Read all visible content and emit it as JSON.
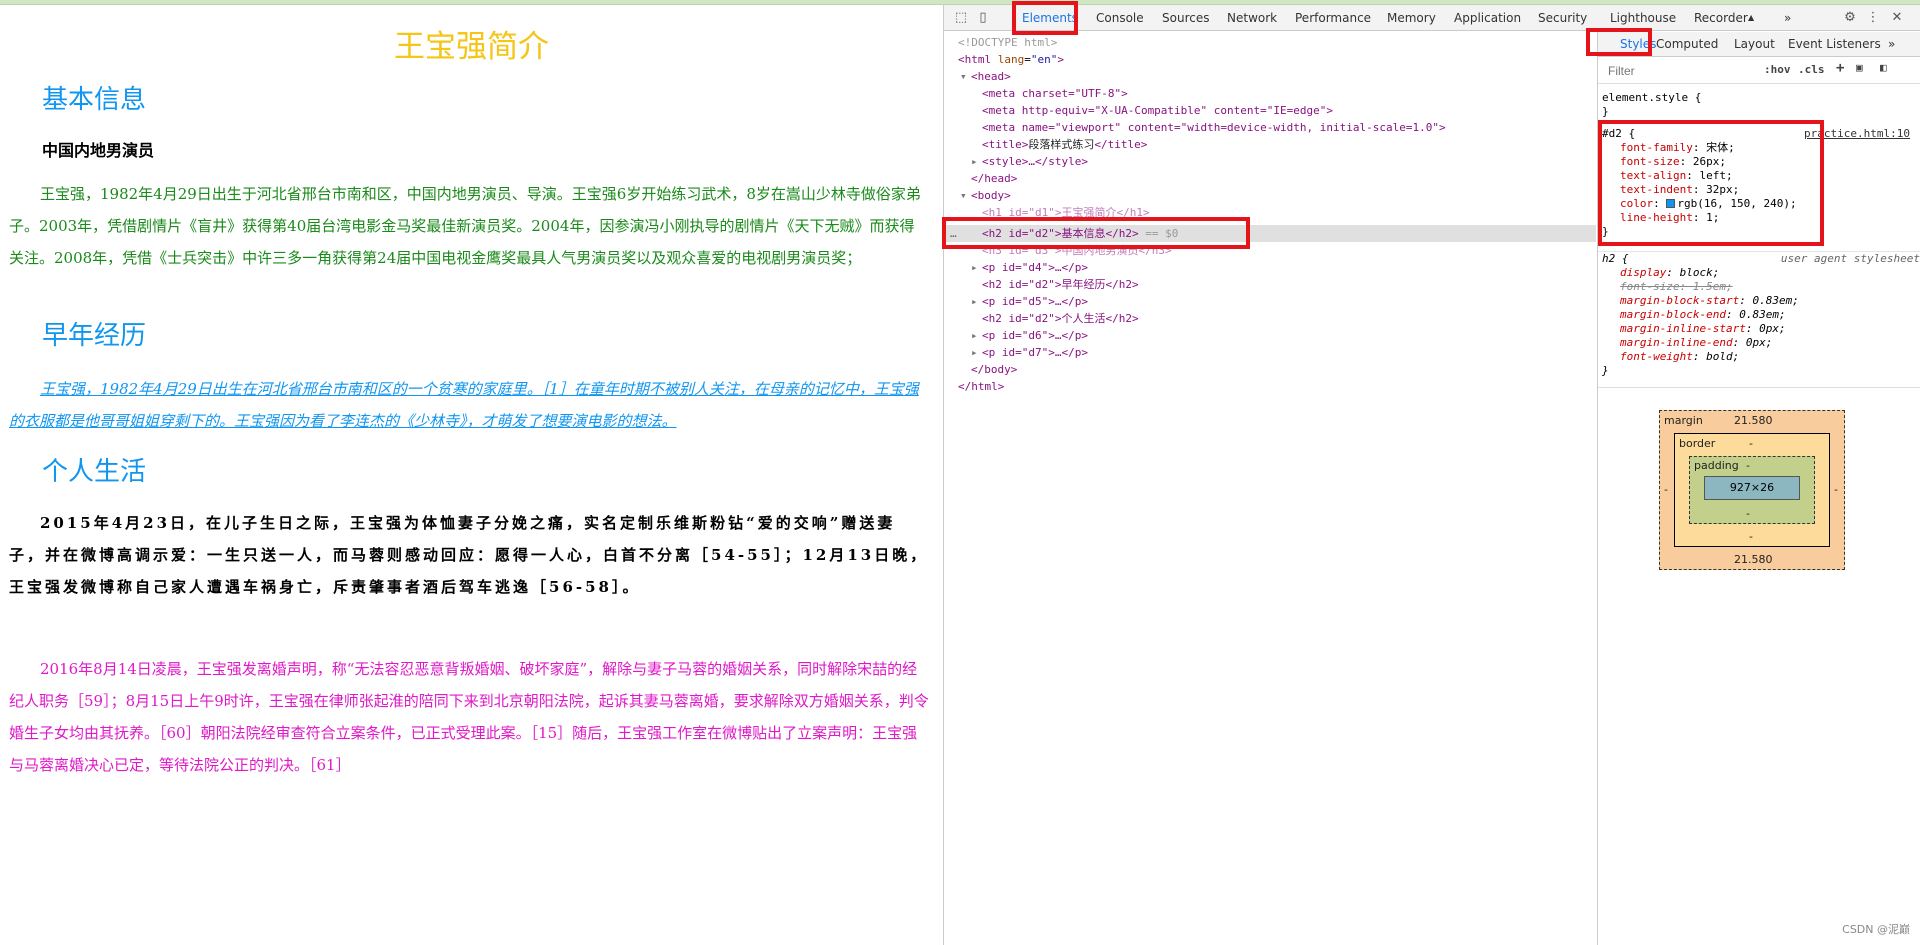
{
  "page": {
    "title": "王宝强简介",
    "heading1": "基本信息",
    "subheading": "中国内地男演员",
    "p4": "王宝强，1982年4月29日出生于河北省邢台市南和区，中国内地男演员、导演。王宝强6岁开始练习武术，8岁在嵩山少林寺做俗家弟子。2003年，凭借剧情片《盲井》获得第40届台湾电影金马奖最佳新演员奖。2004年，因参演冯小刚执导的剧情片《天下无贼》而获得关注。2008年，凭借《士兵突击》中许三多一角获得第24届中国电视金鹰奖最具人气男演员奖以及观众喜爱的电视剧男演员奖；",
    "heading2": "早年经历",
    "p5": "王宝强，1982年4月29日出生在河北省邢台市南和区的一个贫寒的家庭里。［1］在童年时期不被别人关注，在母亲的记忆中，王宝强的衣服都是他哥哥姐姐穿剩下的。王宝强因为看了李连杰的《少林寺》，才萌发了想要演电影的想法。",
    "heading3": "个人生活",
    "p6": "2015年4月23日，在儿子生日之际，王宝强为体恤妻子分娩之痛，实名定制乐维斯粉钻“爱的交响”赠送妻子，并在微博高调示爱：一生只送一人，而马蓉则感动回应：愿得一人心，白首不分离［54-55］；12月13日晚，王宝强发微博称自己家人遭遇车祸身亡，斥责肇事者酒后驾车逃逸［56-58］。",
    "p7": "2016年8月14日凌晨，王宝强发离婚声明，称“无法容忍恶意背叛婚姻、破坏家庭”，解除与妻子马蓉的婚姻关系，同时解除宋喆的经纪人职务［59］；8月15日上午9时许，王宝强在律师张起淮的陪同下来到北京朝阳法院，起诉其妻马蓉离婚，要求解除双方婚姻关系，判令婚生子女均由其抚养。［60］朝阳法院经审查符合立案条件，已正式受理此案。［15］随后，王宝强工作室在微博贴出了立案声明：王宝强与马蓉离婚决心已定，等待法院公正的判决。［61］"
  },
  "devtools": {
    "tabs": [
      "Elements",
      "Console",
      "Sources",
      "Network",
      "Performance",
      "Memory",
      "Application",
      "Security",
      "Lighthouse",
      "Recorder",
      "»"
    ],
    "recorder_flask": "▲",
    "side_tabs": [
      "Styles",
      "Computed",
      "Layout",
      "Event Listeners",
      "»"
    ],
    "filter_placeholder": "Filter",
    "hov": ":hov",
    "cls": ".cls",
    "plus": "+",
    "dom": {
      "doctype": "<!DOCTYPE html>",
      "html_open": "<html",
      "html_lang_attr": "lang",
      "html_lang_val": "\"en\"",
      "head": "<head>",
      "meta1": "<meta charset=\"UTF-8\">",
      "meta2": "<meta http-equiv=\"X-UA-Compatible\" content=\"IE=edge\">",
      "meta3": "<meta name=\"viewport\" content=\"width=device-width, initial-scale=1.0\">",
      "title_open": "<title>",
      "title_text": "段落样式练习",
      "title_close": "</title>",
      "style": "<style>…</style>",
      "head_close": "</head>",
      "body": "<body>",
      "h1": "<h1 id=\"d1\">王宝强简介</h1>",
      "h2_sel": "<h2 id=\"d2\">基本信息</h2>",
      "h2_sel_suffix": "== $0",
      "h3": "<h3 id=\"d3\">中国内地男演员</h3>",
      "p4": "<p id=\"d4\">…</p>",
      "h2b": "<h2 id=\"d2\">早年经历</h2>",
      "p5": "<p id=\"d5\">…</p>",
      "h2c": "<h2 id=\"d2\">个人生活</h2>",
      "p6": "<p id=\"d6\">…</p>",
      "p7": "<p id=\"d7\">…</p>",
      "body_close": "</body>",
      "html_close": "</html>",
      "dots": "…"
    },
    "styles": {
      "element_style": "element.style {",
      "brace": "}",
      "d2_selector": "#d2 {",
      "d2_source": "practice.html:10",
      "d2_props": [
        {
          "name": "font-family",
          "value": "宋体;"
        },
        {
          "name": "font-size",
          "value": "26px;"
        },
        {
          "name": "text-align",
          "value": "left;"
        },
        {
          "name": "text-indent",
          "value": "32px;"
        },
        {
          "name": "color",
          "value": "rgb(16, 150, 240);"
        },
        {
          "name": "line-height",
          "value": "1;"
        }
      ],
      "ua_selector": "h2 {",
      "ua_source": "user agent stylesheet",
      "ua_props": [
        {
          "name": "display",
          "value": "block;"
        },
        {
          "name": "font-size",
          "value": "1.5em;"
        },
        {
          "name": "margin-block-start",
          "value": "0.83em;"
        },
        {
          "name": "margin-block-end",
          "value": "0.83em;"
        },
        {
          "name": "margin-inline-start",
          "value": "0px;"
        },
        {
          "name": "margin-inline-end",
          "value": "0px;"
        },
        {
          "name": "font-weight",
          "value": "bold;"
        }
      ]
    },
    "boxmodel": {
      "margin_label": "margin",
      "margin_top": "21.580",
      "margin_bottom": "21.580",
      "margin_side": "-",
      "border_label": "border",
      "border_val": "-",
      "padding_label": "padding",
      "padding_val": "-",
      "content": "927×26"
    },
    "colors": {
      "accent": "#1a73e8",
      "highlight_red": "#e5141b"
    }
  },
  "watermark": "CSDN @泥巅"
}
